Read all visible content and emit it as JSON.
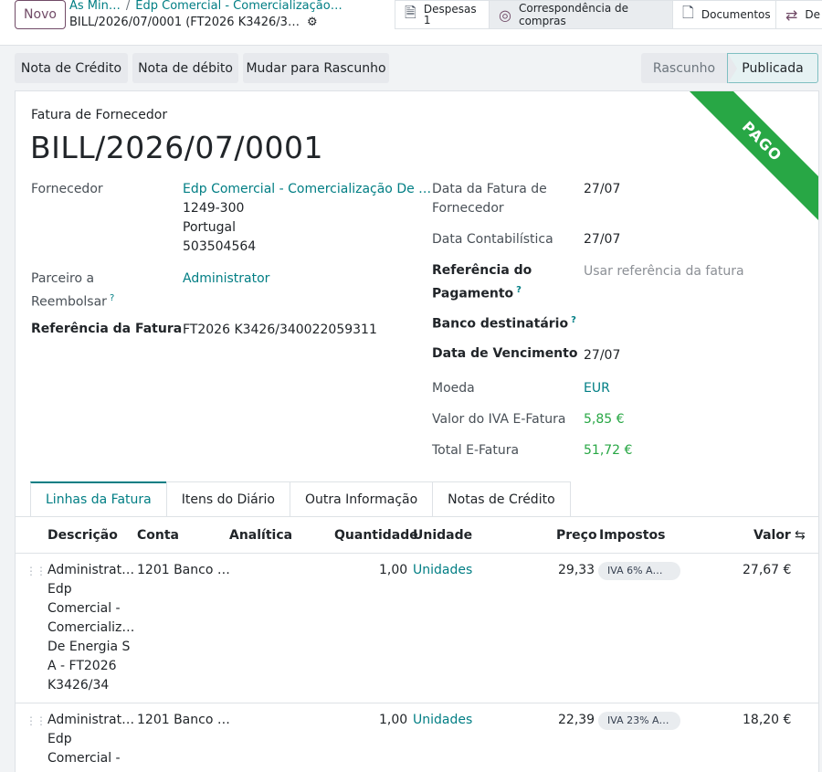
{
  "control": {
    "new_label": "Novo",
    "breadcrumb_1": "As Min…",
    "breadcrumb_2": "Edp Comercial - Comercialização…",
    "record": "BILL/2026/07/0001 (FT2026 K3426/3…"
  },
  "smart_buttons": {
    "expenses_label": "Despesas",
    "expenses_count": "1",
    "purchase_match": "Correspondência de compras",
    "documents": "Documentos",
    "deferred": "De"
  },
  "actions": {
    "credit_note": "Nota de Crédito",
    "debit_note": "Nota de débito",
    "reset_draft": "Mudar para Rascunho"
  },
  "statusbar": {
    "draft": "Rascunho",
    "posted": "Publicada"
  },
  "ribbon": "PAGO",
  "doc": {
    "type": "Fatura de Fornecedor",
    "name": "BILL/2026/07/0001"
  },
  "left_fields": {
    "vendor_label": "Fornecedor",
    "vendor_name": "Edp Comercial - Comercialização De …",
    "vendor_zip": "1249-300",
    "vendor_country": "Portugal",
    "vendor_vat": "503504564",
    "reimburse_label_1": "Parceiro a",
    "reimburse_label_2": "Reembolsar",
    "reimburse_value": "Administrator",
    "ref_label": "Referência da Fatura",
    "ref_value": "FT2026 K3426/340022059311"
  },
  "right_fields": {
    "bill_date_label_1": "Data da Fatura de",
    "bill_date_label_2": "Fornecedor",
    "bill_date": "27/07",
    "acc_date_label": "Data Contabilística",
    "acc_date": "27/07",
    "pay_ref_label_1": "Referência do",
    "pay_ref_label_2": "Pagamento",
    "pay_ref_placeholder": "Usar referência da fatura",
    "bank_label": "Banco destinatário",
    "due_label": "Data de Vencimento",
    "due_date": "27/07",
    "currency_label": "Moeda",
    "currency": "EUR",
    "vat_label": "Valor do IVA E-Fatura",
    "vat_value": "5,85 €",
    "total_label": "Total E-Fatura",
    "total_value": "51,72 €"
  },
  "tabs": [
    "Linhas da Fatura",
    "Itens do Diário",
    "Outra Informação",
    "Notas de Crédito"
  ],
  "columns": {
    "description": "Descrição",
    "account": "Conta",
    "analytic": "Analítica",
    "quantity": "Quantidade",
    "unit": "Unidade",
    "price": "Preço",
    "taxes": "Impostos",
    "amount": "Valor"
  },
  "lines": [
    {
      "desc": [
        "Administrat…",
        "Edp",
        "Comercial -",
        "Comercializ…",
        "De Energia S",
        "A - FT2026",
        "K3426/34"
      ],
      "account": "1201 Banco …",
      "quantity": "1,00",
      "unit": "Unidades",
      "price": "29,33",
      "tax": "IVA 6% A…",
      "amount": "27,67 €"
    },
    {
      "desc": [
        "Administrat…",
        "Edp",
        "Comercial -"
      ],
      "account": "1201 Banco …",
      "quantity": "1,00",
      "unit": "Unidades",
      "price": "22,39",
      "tax": "IVA 23% A…",
      "amount": "18,20 €"
    }
  ]
}
